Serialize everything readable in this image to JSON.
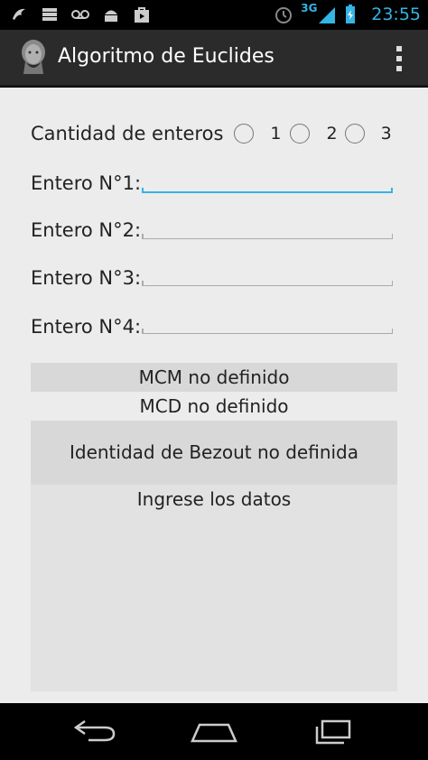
{
  "status_bar": {
    "time": "23:55",
    "network": "3G",
    "left_icons": [
      "notification-icon",
      "storage-icon",
      "voicemail-icon",
      "android-icon",
      "shopping-bag-icon"
    ],
    "right_icons": [
      "clock-icon",
      "signal-icon",
      "battery-icon"
    ]
  },
  "action_bar": {
    "title": "Algoritmo de Euclides"
  },
  "form": {
    "cantidad_label": "Cantidad de enteros",
    "radio_options": [
      "1",
      "2",
      "3"
    ],
    "entries": [
      {
        "label": "Entero N°1:",
        "value": ""
      },
      {
        "label": "Entero N°2:",
        "value": ""
      },
      {
        "label": "Entero N°3:",
        "value": ""
      },
      {
        "label": "Entero N°4:",
        "value": ""
      }
    ]
  },
  "results": {
    "mcm": "MCM no definido",
    "mcd": "MCD no definido",
    "bezout": "Identidad de Bezout no definida",
    "message": "Ingrese los datos"
  },
  "colors": {
    "accent": "#33b5e5",
    "action_bar": "#2b2b2b",
    "background": "#ececec"
  }
}
